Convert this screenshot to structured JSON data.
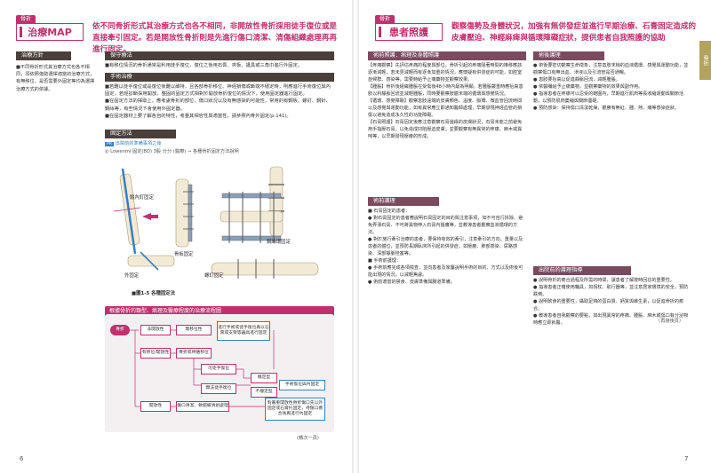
{
  "left": {
    "badge_tag": "骨折",
    "badge_title": "治療MAP",
    "intro": "依不同骨折形式其治療方式也各不相同，非開放性骨折採用徒手復位或是直接牽引固定。若是開放性骨折則是先進行傷口清潔、清傷組織處理再再進行固定。",
    "side_label": "治療方針",
    "side_text": "■不同骨折形式其治療方式也各不相同，須依照傷勢選擇適當的治療方式，有無移位、是否需要外固定等均為選擇治療方式的依據。",
    "sec1_title": "保守療法",
    "sec1_text": "■有移位情況的骨折通常是利用徒手復位，復位之後用石膏、夾板、護具或三角巾進行外固定。",
    "sec2_title": "手術治療",
    "sec2_text": "■若難以徒手復位或是復位後難以維持，且各部骨折移位、神經損傷或斷端不穩定時，則應進行手術復位與內固定，若經診斷採用開放、整固的固定方式相對於開放骨折復位的情況下，使用固定器進行固定。\n■在固定方法的擇取上，應考慮骨折的部位、傷口狀況以及有無感染的可能性，常用的有鋼板、螺釘、鋼針、鋼絲等，有些情況下會使用外固定器。\n■在固定器材上要了解各自的特性，考量其相容性與適當性，請參照內骨外固定(p.141)。",
    "sec3_title": "固定方法",
    "ref_tag": "PR",
    "ref_text": "出院前的準備事項之後",
    "ref_line": "◎ Lowenmi 固定(BO) 3股 分分 (醫療) → 各種骨折固定方法說明",
    "fig_labels": {
      "a": "髓內釘固定",
      "b": "鋼絲環固定",
      "c": "骨板固定",
      "d": "外固定",
      "e": "螺釘固定",
      "f": "一般骨折固定方法"
    },
    "fig_caption": "■圖1-5 各種固定法",
    "flow_title": "根據骨折的類型、病理及醫療程度的治療流程圖",
    "flow": {
      "start": "骨折",
      "n1": "非開放性",
      "n2": "無移位性",
      "n3": "骨折或骨骼移位",
      "n4": "進行手術或徒手復位再以石膏或支架等器具進行固定",
      "n5": "有移位/開放性",
      "n6": "可徒手復位",
      "n7": "穩定型",
      "n8": "不穩定型",
      "n9": "無法徒手復位",
      "n10": "手術復位與內固定",
      "n11": "開放性",
      "n12": "傷口清潔、軟組織清創處理",
      "n13": "對開放骨折傷口進行清創處理後再進行固定",
      "n14": "對嚴重開放性骨折傷口先以外固定或石膏托固定，待傷口癒合後再進行內固定",
      "cont": "(轉次一頁)"
    },
    "page_no": "6"
  },
  "right": {
    "badge_tag": "骨折",
    "badge_title": "患者照護",
    "intro": "觀察傷勢及身體狀況，加強有無併發症並進行早期治療、石膏固定造成的皮膚壓迫、神經麻痺與循環障礙症狀，提供患者自我照護的協助",
    "s1_title": "術前照護．病理及身體照護",
    "s1_text": "【疼痛觀察】先評估疼痛的程度與部位。骨折引起的疼痛隨著時間的推移應該逐漸減輕，若未見減輕而有逐漸加重的情況，應懷疑有併發症的可能，如腔室症候群、感染等，需要時給予止痛藥物並觀察效果。\n【腫脹】骨折後組織腫脹在受傷後48小時內最為明顯。若腫脹嚴重時應抬高患肢以利靜脈回流並減輕腫脹，同時要觀察肢體末端的循環與感覺情況。\n【循環、感覺障礙】觀察患肢遠端的皮膚顏色、溫度、脈搏、微血管回流時間以及感覺與運動功能，如有異常應立即通知醫師處理，早期發現神經血管的損傷以避免造成永久性的功能障礙。\n【石膏照護】石膏固定後應注意觀察石膏邊緣的皮膚狀況，石膏未乾之前避免用手指壓石膏，以免造成凹陷壓迫皮膚；並要觀察有無異常的疼痛、麻木或異味等，以早期發現壓瘡的形成。",
    "s2_title": "術前護理",
    "s2_text": "■ 石膏固定的患者：\n● 對石膏固定的患者應說明石膏固定的目的與注意事項，如不可自行拆除、避免弄濕石膏、不可將異物伸入石膏內搔癢等，並教導患者觀察血液循環的方法。\n● 對於施行牽引治療的患者，要保持有效的牽引，注意牽引的方向、重量以及患者的體位，並預防長期臥床所引起的併發症，如壓瘡、肺部感染、尿路感染、深部靜脈栓塞等。\n■ 手術前護理：\n● 手術前應完成各項檢查，並向患者及家屬說明手術的目的、方式以及術後可能出現的情況，以減輕焦慮。\n● 術前適當的禁食、皮膚準備與腸道準備。",
    "s3_title": "術後護理",
    "s3_text": "● 術後要密切觀察生命徵象，注意患肢末梢的血液循環、感覺與運動功能，並觀察傷口有無出血、滲液以及引流管是否通暢。\n● 患肢要抬高以促進靜脈回流，減輕腫脹。\n● 依醫囑給予止痛藥物，並觀察藥物的效果與副作用。\n● 指導患者在疼痛可以忍受的範圍內，早期進行肌肉等長收縮運動與關節活動，以預防肌肉萎縮與關節僵硬。\n● 預防感染：保持傷口清潔乾燥，觀察有無紅、腫、熱、痛等感染症狀。",
    "s4_title": "出院前的護理指導",
    "s4_text": "● 說明骨折的癒合過程及所需的時間，讓患者了解按時回診的重要性。\n● 指導患者正確使用輔具，如拐杖、助行器等，並注意居家環境的安全，預防跌倒。\n● 說明飲食的重要性，攝取足夠的蛋白質、鈣質與維生素，以促進骨折的癒合。\n● 教導患者自我觀察的要點，如出現異常的疼痛、腫脹、麻木或傷口有分泌物時應立即就醫。",
    "cont": "（再接後頁）",
    "thumb": "骨折",
    "page_no": "7"
  }
}
